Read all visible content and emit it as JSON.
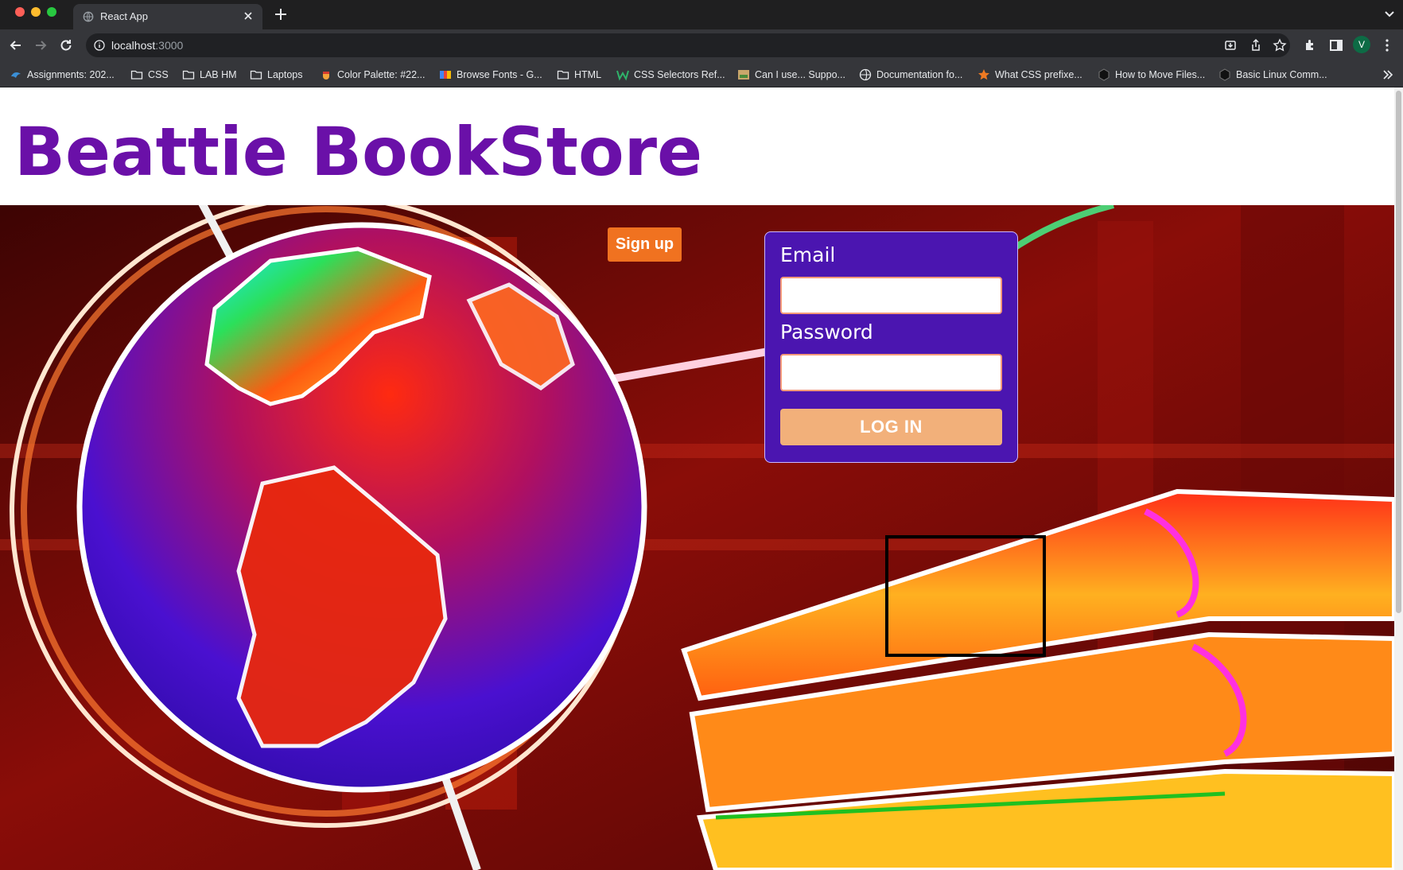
{
  "browser": {
    "tab_title": "React App",
    "url_host": "localhost",
    "url_port": ":3000",
    "profile_initial": "V",
    "bookmarks": [
      {
        "label": "Assignments: 202...",
        "icon": "bird-icon"
      },
      {
        "label": "CSS",
        "icon": "folder-icon"
      },
      {
        "label": "LAB HM",
        "icon": "folder-icon"
      },
      {
        "label": "Laptops",
        "icon": "folder-icon"
      },
      {
        "label": "Color Palette: #22...",
        "icon": "palette-icon"
      },
      {
        "label": "Browse Fonts - G...",
        "icon": "fonts-icon"
      },
      {
        "label": "HTML",
        "icon": "folder-icon"
      },
      {
        "label": "CSS Selectors Ref...",
        "icon": "w-icon"
      },
      {
        "label": "Can I use... Suppo...",
        "icon": "caniuse-icon"
      },
      {
        "label": "Documentation fo...",
        "icon": "globe-icon"
      },
      {
        "label": "What CSS prefixe...",
        "icon": "star-icon"
      },
      {
        "label": "How to Move Files...",
        "icon": "hexagon-icon"
      },
      {
        "label": "Basic Linux Comm...",
        "icon": "hexagon-icon"
      }
    ]
  },
  "page": {
    "title": "Beattie BookStore",
    "signup_label": "Sign up",
    "login": {
      "email_label": "Email",
      "email_value": "",
      "password_label": "Password",
      "password_value": "",
      "submit_label": "LOG IN"
    }
  },
  "colors": {
    "title": "#6a10a8",
    "signup_button": "#f07220",
    "login_panel": "#4b15b0",
    "login_button": "#f2b07a"
  }
}
